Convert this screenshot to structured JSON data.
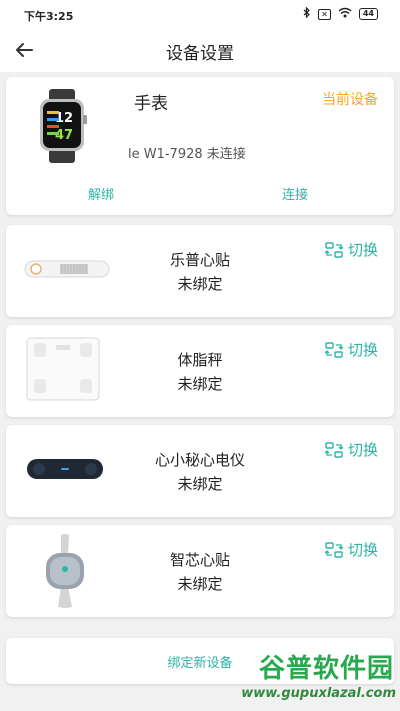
{
  "status_bar": {
    "time": "下午3:25",
    "battery": "44"
  },
  "header": {
    "title": "设备设置"
  },
  "current_device": {
    "name": "手表",
    "badge": "当前设备",
    "info": "le W1-7928 未连接",
    "watch_time_top": "12",
    "watch_time_bottom": "47",
    "unbind_label": "解绑",
    "connect_label": "连接"
  },
  "devices": [
    {
      "name": "乐普心贴",
      "status": "未绑定",
      "switch_label": "切换",
      "icon": "patch-strip-image"
    },
    {
      "name": "体脂秤",
      "status": "未绑定",
      "switch_label": "切换",
      "icon": "body-scale-image"
    },
    {
      "name": "心小秘心电仪",
      "status": "未绑定",
      "switch_label": "切换",
      "icon": "ecg-device-image"
    },
    {
      "name": "智芯心贴",
      "status": "未绑定",
      "switch_label": "切换",
      "icon": "smart-patch-image"
    }
  ],
  "bind_new": {
    "label": "绑定新设备"
  },
  "watermark": {
    "logo": "谷普软件园",
    "url": "www.gupuxlazal.com"
  },
  "colors": {
    "accent": "#2bb5a5",
    "badge": "#f5a623",
    "background": "#f1f1f1"
  }
}
